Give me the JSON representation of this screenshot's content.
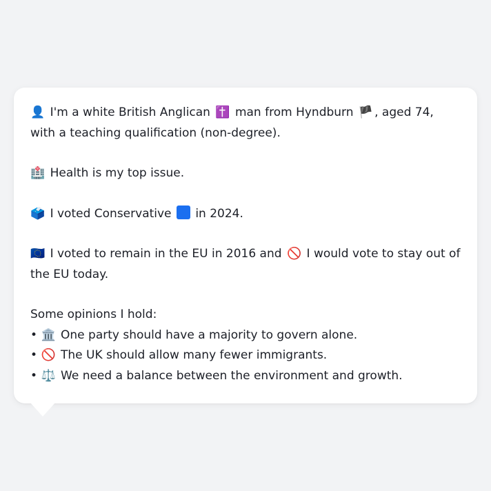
{
  "colors": {
    "page_background": "#f2f3f5",
    "card_background": "#ffffff",
    "text": "#1c1f27",
    "conservative_square": "#1b6ff0"
  },
  "profile": {
    "p1_emoji": "👤",
    "p1_text_a": "I'm a white British Anglican",
    "p1_religion_emoji": "✝️",
    "p1_text_b": "man from Hyndburn",
    "p1_flag_emoji": "🏴",
    "p1_text_c": ", aged 74, with a teaching qualification (non-degree).",
    "p2_emoji": "🏥",
    "p2_text": "Health is my top issue.",
    "p3_emoji": "🗳️",
    "p3_text_a": "I voted Conservative",
    "p3_party_icon": "blue-square",
    "p3_text_b": "in 2024.",
    "p4_emoji": "🇪🇺",
    "p4_text_a": "I voted to remain in the EU in 2016 and",
    "p4_no_emoji": "🚫",
    "p4_text_b": "I would vote to stay out of the EU today."
  },
  "opinions": {
    "title": "Some opinions I hold:",
    "bullet": "•",
    "items": [
      {
        "emoji": "🏛️",
        "text": "One party should have a majority to govern alone."
      },
      {
        "emoji": "🚫",
        "text": "The UK should allow many fewer immigrants."
      },
      {
        "emoji": "⚖️",
        "text": "We need a balance between the environment and growth."
      }
    ]
  }
}
